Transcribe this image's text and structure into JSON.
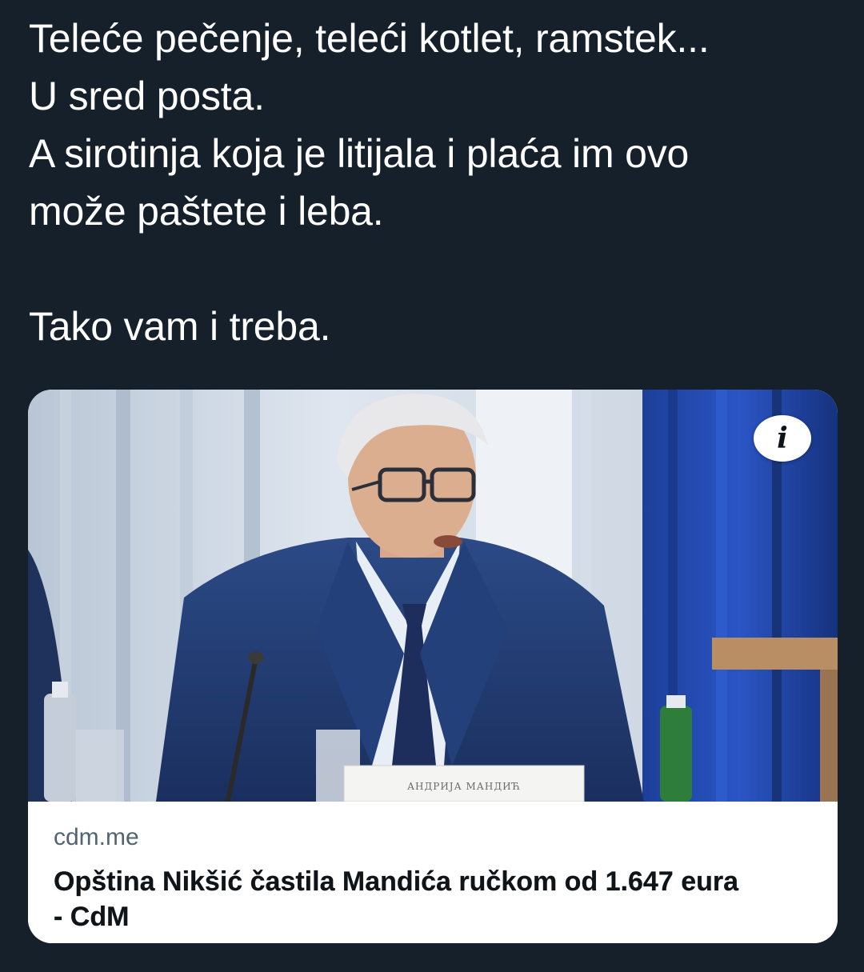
{
  "tweet": {
    "lines": [
      "Teleće pečenje, teleći kotlet, ramstek...",
      "U sred posta.",
      "A sirotinja koja je litijala i plaća im ovo",
      "može paštete i leba.",
      "Tako vam i treba."
    ]
  },
  "link_card": {
    "nameplate": "АНДРИЈА МАНДИЋ",
    "info_icon": "info-icon",
    "domain": "cdm.me",
    "title_line1": "Opština Nikšić častila Mandića ručkom od 1.647 eura",
    "title_line2": "- CdM"
  },
  "colors": {
    "background": "#15202b",
    "text": "#ffffff",
    "card_background": "#ffffff",
    "domain_text": "#536471",
    "headline_text": "#0f1419"
  }
}
